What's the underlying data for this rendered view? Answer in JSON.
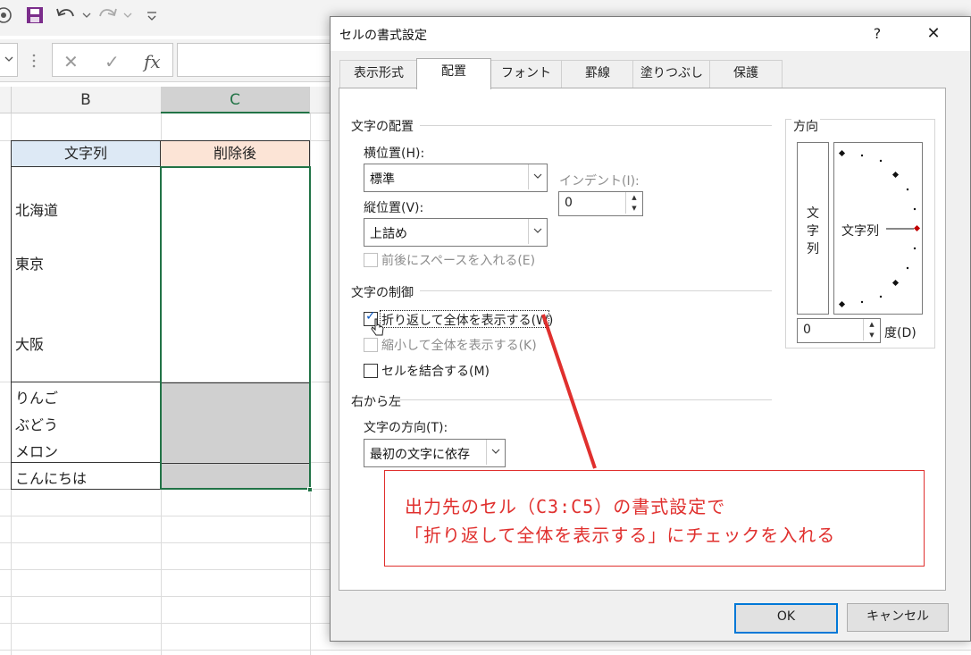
{
  "excel": {
    "toolbar": {
      "icons": [
        "autosave-icon",
        "save-icon",
        "undo-icon",
        "redo-icon",
        "customize-qat-icon"
      ],
      "formula_cancel": "✕",
      "formula_enter": "✓",
      "formula_fx": "fx"
    },
    "columns": [
      "B",
      "C"
    ],
    "cells": {
      "b2": "文字列",
      "c2": "削除後",
      "b3_lines": [
        "北海道",
        "東京",
        "大阪"
      ],
      "b4_lines": [
        "りんご",
        "ぶどう",
        "メロン"
      ],
      "b5": "こんにちは"
    },
    "colors": {
      "header_b": "#dde9f5",
      "header_c": "#fce4d6",
      "selected_col": "#d2d2d2",
      "selection_border": "#217346",
      "gray_fill": "#d0d0d0"
    }
  },
  "dialog": {
    "title": "セルの書式設定",
    "help": "?",
    "close": "✕",
    "tabs": [
      "表示形式",
      "配置",
      "フォント",
      "罫線",
      "塗りつぶし",
      "保護"
    ],
    "active_tab": "配置",
    "text_alignment": {
      "title": "文字の配置",
      "horizontal_label": "横位置(H):",
      "horizontal_value": "標準",
      "vertical_label": "縦位置(V):",
      "vertical_value": "上詰め",
      "indent_label": "インデント(I):",
      "indent_value": "0",
      "justify_distributed_label": "前後にスペースを入れる(E)"
    },
    "text_control": {
      "title": "文字の制御",
      "wrap_text_label": "折り返して全体を表示する(W)",
      "wrap_text_checked": true,
      "shrink_label": "縮小して全体を表示する(K)",
      "merge_label": "セルを結合する(M)"
    },
    "rtl": {
      "title": "右から左",
      "direction_label": "文字の方向(T):",
      "direction_value": "最初の文字に依存"
    },
    "orientation": {
      "title": "方向",
      "vertical_chars": [
        "文",
        "字",
        "列"
      ],
      "dial_text": "文字列",
      "degrees_value": "0",
      "degrees_label": "度(D)"
    },
    "ok": "OK",
    "cancel": "キャンセル"
  },
  "annotation": {
    "line1": "出力先のセル（C3:C5）の書式設定で",
    "line2": "「折り返して全体を表示する」にチェックを入れる",
    "color": "#e0302e"
  }
}
